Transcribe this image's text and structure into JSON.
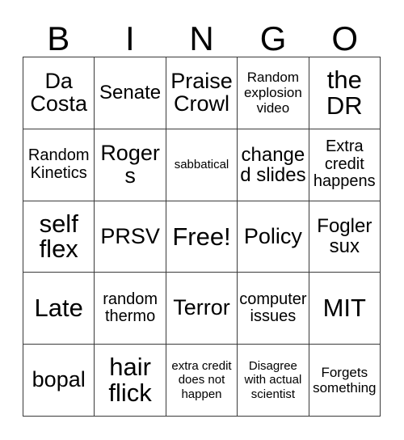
{
  "card": {
    "title": "BINGO",
    "header_letters": [
      "B",
      "I",
      "N",
      "G",
      "O"
    ],
    "colors": {
      "background": "#ffffff",
      "text": "#000000",
      "grid_line": "#3a3a3a"
    },
    "grid": {
      "rows": 5,
      "columns": 5,
      "free_space": "Free!",
      "free_space_position": "center"
    },
    "cells": [
      {
        "text": "Da Costa",
        "size": "xl",
        "row": 1,
        "col": 1
      },
      {
        "text": "Senate",
        "size": "lg",
        "row": 1,
        "col": 2
      },
      {
        "text": "Praise Crowl",
        "size": "xl",
        "row": 1,
        "col": 3
      },
      {
        "text": "Random explosion video",
        "size": "sm",
        "row": 1,
        "col": 4
      },
      {
        "text": "the DR",
        "size": "xxl",
        "row": 1,
        "col": 5
      },
      {
        "text": "Random Kinetics",
        "size": "md",
        "row": 2,
        "col": 1
      },
      {
        "text": "Rogers",
        "size": "xl",
        "row": 2,
        "col": 2
      },
      {
        "text": "sabbatical",
        "size": "xs",
        "row": 2,
        "col": 3
      },
      {
        "text": "changed slides",
        "size": "lg",
        "row": 2,
        "col": 4
      },
      {
        "text": "Extra credit happens",
        "size": "md",
        "row": 2,
        "col": 5
      },
      {
        "text": "self flex",
        "size": "xxl",
        "row": 3,
        "col": 1
      },
      {
        "text": "PRSV",
        "size": "xl",
        "row": 3,
        "col": 2
      },
      {
        "text": "Free!",
        "size": "xxl",
        "row": 3,
        "col": 3
      },
      {
        "text": "Policy",
        "size": "xl",
        "row": 3,
        "col": 4
      },
      {
        "text": "Fogler sux",
        "size": "lg",
        "row": 3,
        "col": 5
      },
      {
        "text": "Late",
        "size": "xxl",
        "row": 4,
        "col": 1
      },
      {
        "text": "random thermo",
        "size": "md",
        "row": 4,
        "col": 2
      },
      {
        "text": "Terror",
        "size": "xl",
        "row": 4,
        "col": 3
      },
      {
        "text": "computer issues",
        "size": "md",
        "row": 4,
        "col": 4
      },
      {
        "text": "MIT",
        "size": "xxl",
        "row": 4,
        "col": 5
      },
      {
        "text": "bopal",
        "size": "xl",
        "row": 5,
        "col": 1
      },
      {
        "text": "hair flick",
        "size": "xxl",
        "row": 5,
        "col": 2
      },
      {
        "text": "extra credit does not happen",
        "size": "xs",
        "row": 5,
        "col": 3
      },
      {
        "text": "Disagree with actual scientist",
        "size": "xs",
        "row": 5,
        "col": 4
      },
      {
        "text": "Forgets something",
        "size": "sm",
        "row": 5,
        "col": 5
      }
    ]
  }
}
